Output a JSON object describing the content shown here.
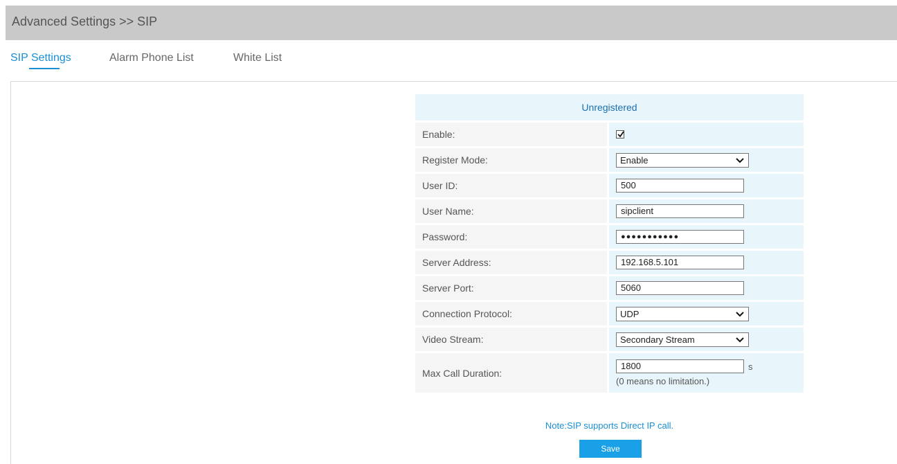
{
  "header": {
    "title": "Advanced Settings >> SIP"
  },
  "tabs": [
    {
      "label": "SIP Settings",
      "active": true
    },
    {
      "label": "Alarm Phone List",
      "active": false
    },
    {
      "label": "White List",
      "active": false
    }
  ],
  "form": {
    "status": "Unregistered",
    "enable": {
      "label": "Enable:",
      "checked": true
    },
    "register_mode": {
      "label": "Register Mode:",
      "value": "Enable"
    },
    "user_id": {
      "label": "User ID:",
      "value": "500"
    },
    "user_name": {
      "label": "User Name:",
      "value": "sipclient"
    },
    "password": {
      "label": "Password:",
      "value": "●●●●●●●●●●●"
    },
    "server_address": {
      "label": "Server Address:",
      "value": "192.168.5.101"
    },
    "server_port": {
      "label": "Server Port:",
      "value": "5060"
    },
    "connection_protocol": {
      "label": "Connection Protocol:",
      "value": "UDP"
    },
    "video_stream": {
      "label": "Video Stream:",
      "value": "Secondary Stream"
    },
    "max_call_duration": {
      "label": "Max Call Duration:",
      "value": "1800",
      "unit": "s",
      "hint": "(0 means no limitation.)"
    }
  },
  "note": "Note:SIP supports Direct IP call.",
  "save_label": "Save",
  "colors": {
    "accent": "#1a8fd6",
    "button": "#1aa0e6",
    "row_value_bg": "#e8f6fc",
    "row_label_bg": "#f5f5f5",
    "titlebar": "#c9c9c9"
  }
}
